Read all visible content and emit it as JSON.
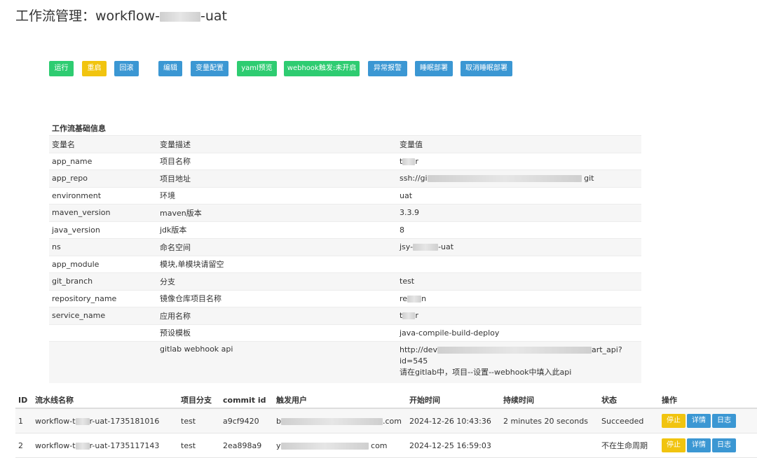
{
  "page": {
    "title_prefix": "工作流管理：workflow-",
    "title_suffix": "-uat"
  },
  "toolbar": [
    {
      "label": "运行",
      "color": "green"
    },
    {
      "label": "重启",
      "color": "yellow"
    },
    {
      "label": "回滚",
      "color": "blue"
    },
    {
      "label": "编辑",
      "color": "blue"
    },
    {
      "label": "变量配置",
      "color": "blue"
    },
    {
      "label": "yaml预览",
      "color": "green"
    },
    {
      "label": "webhook触发:未开启",
      "color": "green"
    },
    {
      "label": "异常报警",
      "color": "blue"
    },
    {
      "label": "睡眠部署",
      "color": "blue"
    },
    {
      "label": "取消睡眠部署",
      "color": "blue"
    }
  ],
  "info": {
    "section_title": "工作流基础信息",
    "header": {
      "name": "变量名",
      "desc": "变量描述",
      "value": "变量值"
    },
    "rows": [
      {
        "name": "app_name",
        "desc": "项目名称",
        "value_prefix": "t",
        "value_suffix": "r"
      },
      {
        "name": "app_repo",
        "desc": "项目地址",
        "value_prefix": "ssh://gi",
        "value_suffix": "git"
      },
      {
        "name": "environment",
        "desc": "环境",
        "value": "uat"
      },
      {
        "name": "maven_version",
        "desc": "maven版本",
        "value": "3.3.9"
      },
      {
        "name": "java_version",
        "desc": "jdk版本",
        "value": "8"
      },
      {
        "name": "ns",
        "desc": "命名空间",
        "value_prefix": "jsy-",
        "value_suffix": "-uat"
      },
      {
        "name": "app_module",
        "desc": "模块,单模块请留空",
        "value": ""
      },
      {
        "name": "git_branch",
        "desc": "分支",
        "value": "test"
      },
      {
        "name": "repository_name",
        "desc": "镜像仓库项目名称",
        "value_prefix": "re",
        "value_suffix": "n"
      },
      {
        "name": "service_name",
        "desc": "应用名称",
        "value_prefix": "t",
        "value_suffix": "r"
      },
      {
        "name": "",
        "desc": "预设模板",
        "value": "java-compile-build-deploy"
      }
    ],
    "webhook": {
      "desc": "gitlab webhook api",
      "line1_prefix": "http://dev",
      "line1_suffix": "art_api?",
      "line2": "id=545",
      "line3": "请在gitlab中，项目--设置--webhook中填入此api"
    }
  },
  "pipelines": {
    "headers": [
      "ID",
      "流水线名称",
      "项目分支",
      "commit id",
      "触发用户",
      "开始时间",
      "持续时间",
      "状态",
      "操作"
    ],
    "rows": [
      {
        "id": "1",
        "name_prefix": "workflow-t",
        "name_suffix": "r-uat-1735181016",
        "branch": "test",
        "commit": "a9cf9420",
        "user_prefix": "b",
        "user_suffix": ".com",
        "start": "2024-12-26 10:43:36",
        "duration": "2 minutes 20 seconds",
        "status": "Succeeded"
      },
      {
        "id": "2",
        "name_prefix": "workflow-t",
        "name_suffix": "r-uat-1735117143",
        "branch": "test",
        "commit": "2ea898a9",
        "user_prefix": "y",
        "user_suffix": "com",
        "start": "2024-12-25 16:59:03",
        "duration": "",
        "status": "不在生命周期"
      }
    ],
    "actions": {
      "stop": "停止",
      "detail": "详情",
      "log": "日志"
    }
  },
  "colors": {
    "green": "#2ecc71",
    "yellow": "#f1c40f",
    "blue": "#3b97d3"
  }
}
